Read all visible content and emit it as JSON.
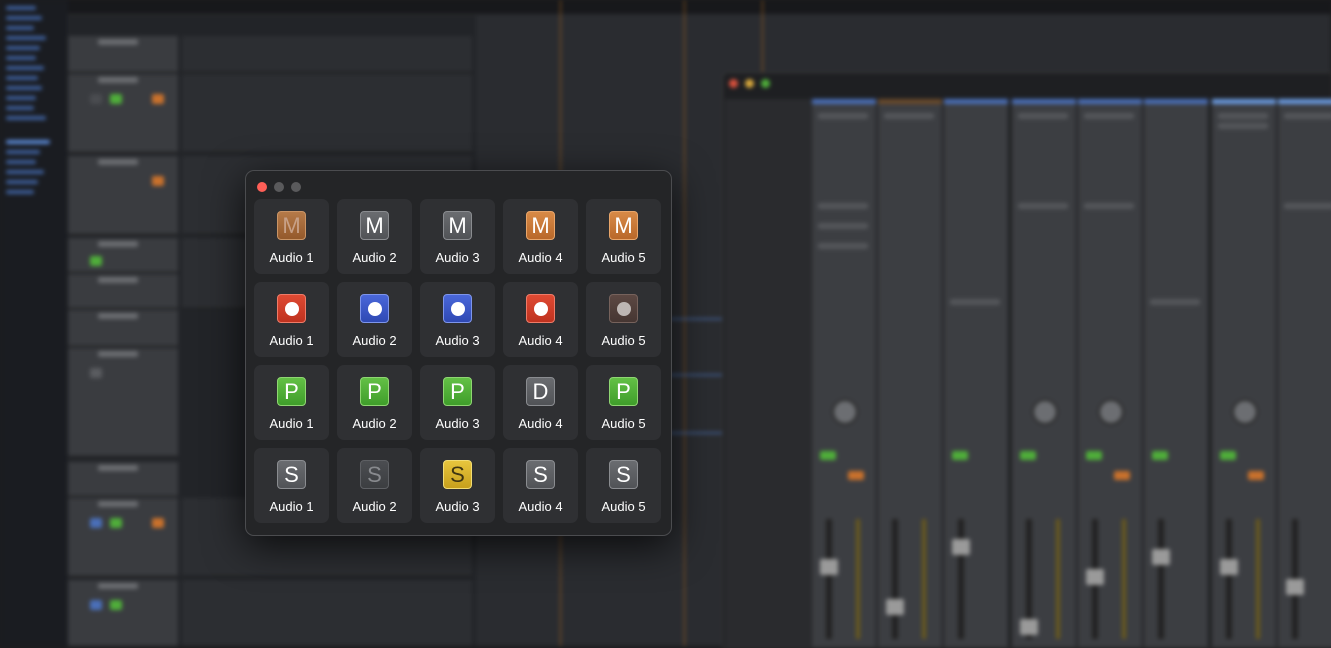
{
  "panel": {
    "rows": [
      {
        "kind": "mute",
        "cells": [
          {
            "label": "Audio 1",
            "glyph": "M",
            "style": "m-dim"
          },
          {
            "label": "Audio 2",
            "glyph": "M",
            "style": "gray"
          },
          {
            "label": "Audio 3",
            "glyph": "M",
            "style": "gray"
          },
          {
            "label": "Audio 4",
            "glyph": "M",
            "style": "m-on"
          },
          {
            "label": "Audio 5",
            "glyph": "M",
            "style": "m-on"
          }
        ]
      },
      {
        "kind": "record",
        "cells": [
          {
            "label": "Audio 1",
            "glyph": "",
            "style": "rec-red"
          },
          {
            "label": "Audio 2",
            "glyph": "",
            "style": "rec-blue"
          },
          {
            "label": "Audio 3",
            "glyph": "",
            "style": "rec-blue"
          },
          {
            "label": "Audio 4",
            "glyph": "",
            "style": "rec-red"
          },
          {
            "label": "Audio 5",
            "glyph": "",
            "style": "rec-off"
          }
        ]
      },
      {
        "kind": "playback",
        "cells": [
          {
            "label": "Audio 1",
            "glyph": "P",
            "style": "green"
          },
          {
            "label": "Audio 2",
            "glyph": "P",
            "style": "green"
          },
          {
            "label": "Audio 3",
            "glyph": "P",
            "style": "green"
          },
          {
            "label": "Audio 4",
            "glyph": "D",
            "style": "gray"
          },
          {
            "label": "Audio 5",
            "glyph": "P",
            "style": "green"
          }
        ]
      },
      {
        "kind": "solo",
        "cells": [
          {
            "label": "Audio 1",
            "glyph": "S",
            "style": "gray"
          },
          {
            "label": "Audio 2",
            "glyph": "S",
            "style": "gray-dim"
          },
          {
            "label": "Audio 3",
            "glyph": "S",
            "style": "yellow"
          },
          {
            "label": "Audio 4",
            "glyph": "S",
            "style": "gray"
          },
          {
            "label": "Audio 5",
            "glyph": "S",
            "style": "gray"
          }
        ]
      }
    ]
  },
  "colors": {
    "close": "#ff5f57",
    "minimize": "#5a5a5c",
    "zoom": "#5a5a5c",
    "mute_orange": "#c9712c",
    "playback_green": "#4fae3a",
    "solo_yellow": "#d9b52a",
    "record_red": "#d23f28",
    "record_blue": "#3b57c7"
  }
}
